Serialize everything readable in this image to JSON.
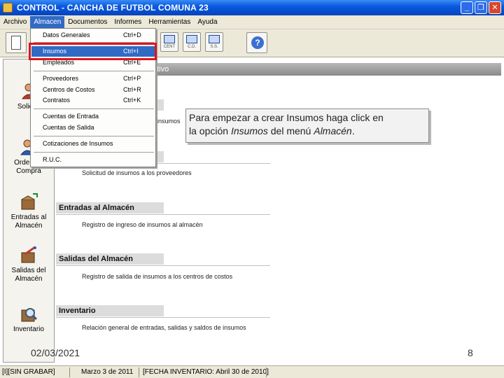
{
  "window": {
    "title": "CONTROL  -  CANCHA DE FUTBOL COMUNA 23",
    "buttons": [
      "_",
      "❐",
      "✕"
    ]
  },
  "menubar": [
    "Archivo",
    "Almacen",
    "Documentos",
    "Informes",
    "Herramientas",
    "Ayuda"
  ],
  "toolbar": {
    "small_captions": [
      "CENT",
      "C.D.",
      "S.S."
    ],
    "help": "?"
  },
  "sidebar": [
    {
      "label": "Solicitu",
      "icon": "person-icon"
    },
    {
      "label": "Orden de Compra",
      "icon": "person-order-icon"
    },
    {
      "label": "Entradas al Almacén",
      "icon": "box-in-icon"
    },
    {
      "label": "Salidas del Almacén",
      "icon": "box-out-icon"
    },
    {
      "label": "Inventario",
      "icon": "inventory-icon"
    }
  ],
  "header_strip": "ptivo",
  "sections": [
    {
      "title": "",
      "desc": "Solicitud de insumos a los proveedores"
    },
    {
      "title": "Entradas al Almacén",
      "desc": "Registro de ingreso de insumos al almacén"
    },
    {
      "title": "Salidas del Almacén",
      "desc": "Registro de salida de insumos a los centros de costos"
    },
    {
      "title": "Inventario",
      "desc": "Relación general de entradas, salidas y saldos de insumos"
    }
  ],
  "partial_desc": "insumos",
  "dropdown": {
    "items": [
      {
        "label": "Datos Generales",
        "shortcut": "Ctrl+D"
      },
      {
        "label": "Insumos",
        "shortcut": "Ctrl+I"
      },
      {
        "label": "Empleados",
        "shortcut": "Ctrl+E"
      },
      {
        "label": "Proveedores",
        "shortcut": "Ctrl+P"
      },
      {
        "label": "Centros de Costos",
        "shortcut": "Ctrl+R"
      },
      {
        "label": "Contratos",
        "shortcut": "Ctrl+K"
      },
      {
        "label": "Cuentas de Entrada",
        "shortcut": ""
      },
      {
        "label": "Cuentas de Salida",
        "shortcut": ""
      },
      {
        "label": "Cotizaciones de Insumos",
        "shortcut": ""
      },
      {
        "label": "R.U.C.",
        "shortcut": ""
      }
    ]
  },
  "tooltip": {
    "line1": "Para empezar a crear Insumos haga click en",
    "line2_pre": "la opción ",
    "line2_em1": "Insumos",
    "line2_mid": " del menú ",
    "line2_em2": "Almacén",
    "line2_post": "."
  },
  "footer": {
    "date": "02/03/2021",
    "page": "8"
  },
  "status": {
    "cell1": "[I][SIN GRABAR]",
    "cell2": "Marzo 3 de 2011",
    "cell3": "[FECHA INVENTARIO: Abril 30 de 2010]"
  },
  "colors": {
    "titlebar": "#0a5ae0",
    "menu_selected": "#316ac5",
    "highlight": "#e0141a"
  }
}
